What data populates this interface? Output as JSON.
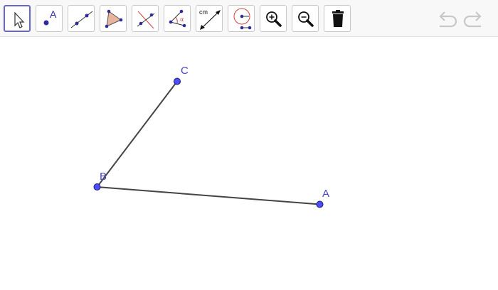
{
  "toolbar": {
    "tools": [
      {
        "name": "move-tool",
        "icon": "arrow-cursor-icon"
      },
      {
        "name": "point-tool",
        "icon": "point-icon",
        "label": "A"
      },
      {
        "name": "line-tool",
        "icon": "line-through-points-icon"
      },
      {
        "name": "polygon-tool",
        "icon": "polygon-icon"
      },
      {
        "name": "perpendicular-line-tool",
        "icon": "perpendicular-icon"
      },
      {
        "name": "angle-tool",
        "icon": "angle-icon",
        "label": "α"
      },
      {
        "name": "distance-tool",
        "icon": "distance-length-icon",
        "label": "cm"
      },
      {
        "name": "circle-tool",
        "icon": "circle-with-center-icon"
      },
      {
        "name": "zoom-in-tool",
        "icon": "zoom-in-icon"
      },
      {
        "name": "zoom-out-tool",
        "icon": "zoom-out-icon"
      },
      {
        "name": "delete-tool",
        "icon": "trash-icon"
      }
    ],
    "selected_tool": "move-tool",
    "undo_icon": "undo-icon",
    "redo_icon": "redo-icon"
  },
  "canvas": {
    "points": [
      {
        "label": "A"
      },
      {
        "label": "B"
      },
      {
        "label": "C"
      }
    ],
    "segments": [
      {
        "from": "B",
        "to": "A"
      },
      {
        "from": "B",
        "to": "C"
      }
    ],
    "colors": {
      "point_fill": "#4d4dff",
      "point_stroke": "#1a1a66",
      "label": "#4646c8",
      "segment": "#444444",
      "selected_tool_border": "#6666cc"
    }
  }
}
